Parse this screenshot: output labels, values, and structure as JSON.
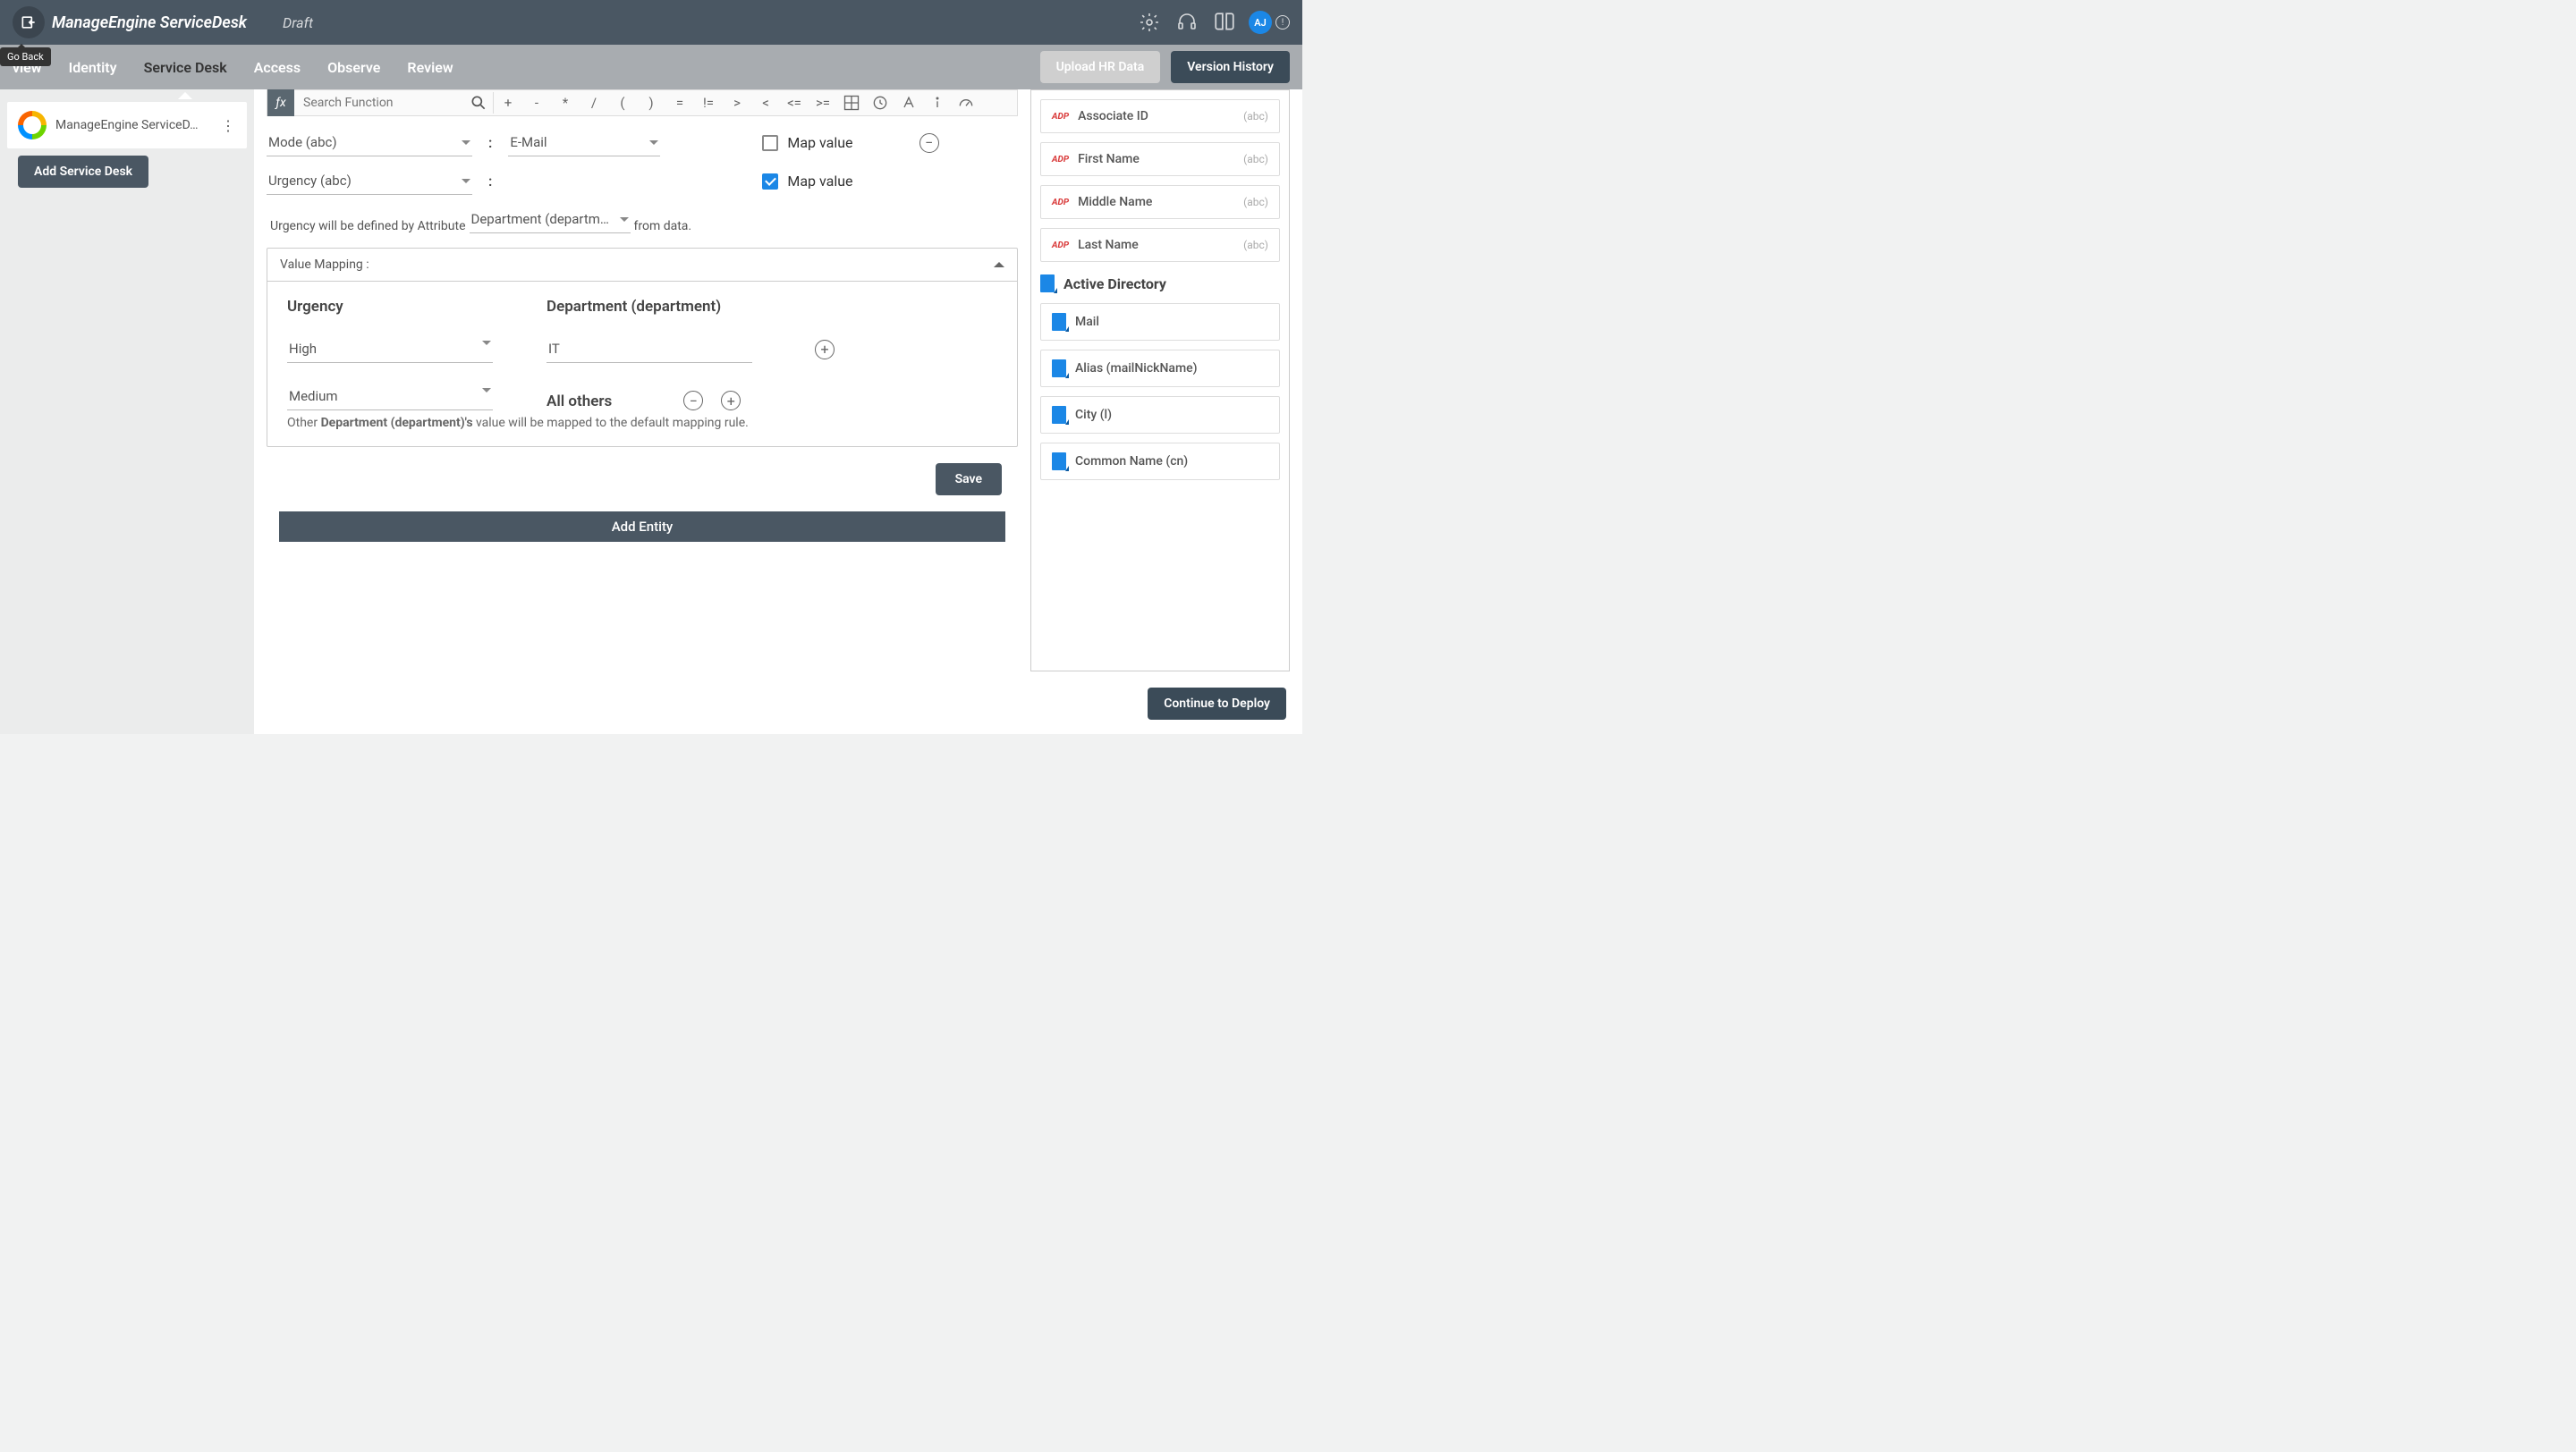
{
  "header": {
    "back_tooltip": "Go Back",
    "app_title": "ManageEngine ServiceDesk",
    "draft": "Draft",
    "avatar": "AJ"
  },
  "nav": {
    "tabs": [
      "view",
      "Identity",
      "Service Desk",
      "Access",
      "Observe",
      "Review"
    ],
    "upload": "Upload HR Data",
    "version": "Version History"
  },
  "sidebar": {
    "item_label": "ManageEngine ServiceD…",
    "add": "Add Service Desk"
  },
  "toolbar": {
    "search_placeholder": "Search Function",
    "ops": [
      "+",
      "-",
      "*",
      "/",
      "(",
      ")",
      "=",
      "!=",
      ">",
      "<",
      "<=",
      ">="
    ]
  },
  "fields": {
    "mode_label": "Mode (abc)",
    "mode_value": "E-Mail",
    "urgency_label": "Urgency (abc)",
    "map_value": "Map value",
    "sentence_pre": "Urgency will be defined by Attribute",
    "dept_attr": "Department (departm…",
    "sentence_post": "from data."
  },
  "vm": {
    "title": "Value Mapping :",
    "col1": "Urgency",
    "col2": "Department (department)",
    "row1_val": "High",
    "row1_dept": "IT",
    "row2_val": "Medium",
    "row2_text": "All others",
    "note_pre": "Other ",
    "note_bold": "Department (department)'s",
    "note_post": " value will be mapped to the default mapping rule."
  },
  "attrs": {
    "adp": [
      {
        "label": "Associate ID",
        "type": "(abc)"
      },
      {
        "label": "First Name",
        "type": "(abc)"
      },
      {
        "label": "Middle Name",
        "type": "(abc)"
      },
      {
        "label": "Last Name",
        "type": "(abc)"
      }
    ],
    "ad_title": "Active Directory",
    "ad": [
      {
        "label": "Mail"
      },
      {
        "label": "Alias (mailNickName)"
      },
      {
        "label": "City (l)"
      },
      {
        "label": "Common Name (cn)"
      }
    ]
  },
  "buttons": {
    "save": "Save",
    "add_entity": "Add Entity",
    "deploy": "Continue to Deploy"
  }
}
